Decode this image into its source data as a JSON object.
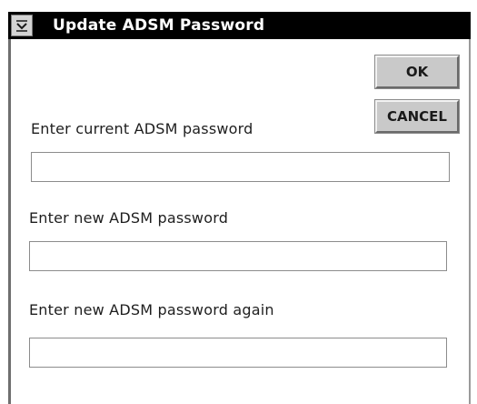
{
  "window": {
    "title": "Update ADSM Password"
  },
  "icons": {
    "system_menu": "system-menu-icon"
  },
  "buttons": {
    "ok_label": "OK",
    "cancel_label": "CANCEL"
  },
  "form": {
    "current_password_label": "Enter current ADSM password",
    "current_password_value": "",
    "new_password_label": "Enter new ADSM password",
    "new_password_value": "",
    "confirm_password_label": "Enter new ADSM password again",
    "confirm_password_value": ""
  },
  "colors": {
    "titlebar": "#000000",
    "title_text": "#ffffff",
    "button_face": "#c9c9c9",
    "window_bg": "#ffffff"
  }
}
